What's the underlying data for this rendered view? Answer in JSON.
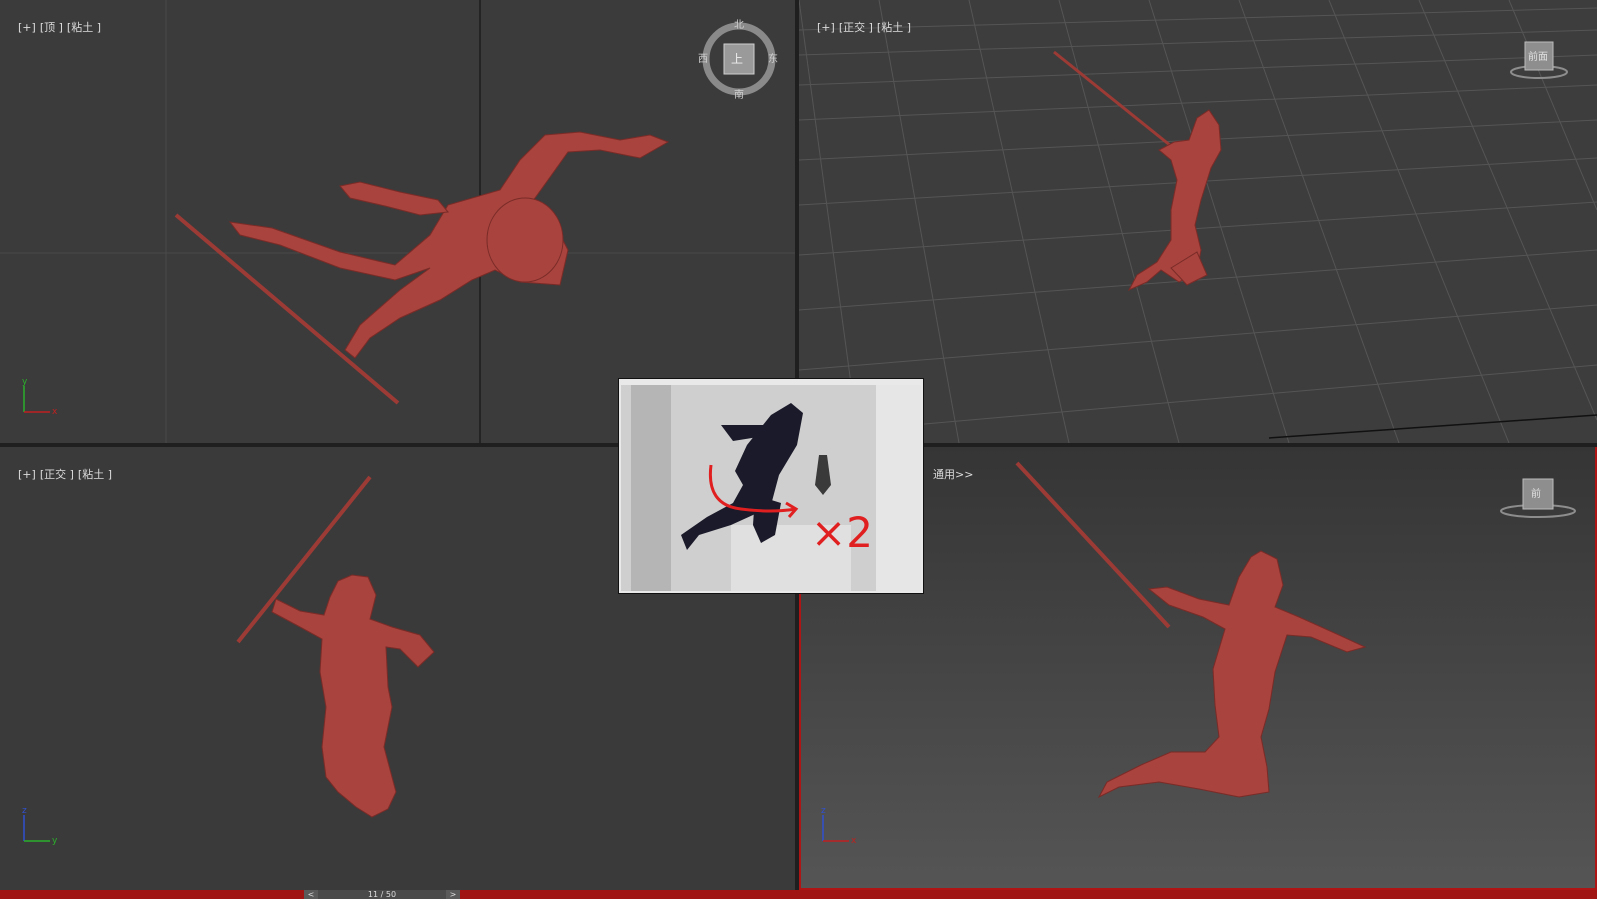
{
  "viewports": {
    "top_left": {
      "plus": "[+]",
      "view": "[顶 ]",
      "shading": "[粘土 ]"
    },
    "top_right": {
      "plus": "[+]",
      "view": "[正交 ]",
      "shading": "[粘土 ]"
    },
    "bottom_left": {
      "plus": "[+]",
      "view": "[正交 ]",
      "shading": "[粘土 ]"
    },
    "bottom_right": {
      "label_fragment": "通用>>"
    }
  },
  "viewcube": {
    "north": "北",
    "south": "南",
    "east": "东",
    "west": "西",
    "top_face": "上",
    "front_face": "前面",
    "left_cube_face": "前"
  },
  "axes": {
    "top_left": {
      "v": "y",
      "h": "x"
    },
    "bottom_left": {
      "v": "z",
      "h": "y"
    },
    "bottom_right": {
      "v": "z",
      "h": "x"
    }
  },
  "reference_image": {
    "annotation": "×2"
  },
  "timeline": {
    "frame_text": "11 / 50",
    "prev": "<",
    "next": ">"
  },
  "colors": {
    "model": "#a8433e",
    "active_border": "#b01515",
    "viewport_bg": "#3a3a3a"
  }
}
